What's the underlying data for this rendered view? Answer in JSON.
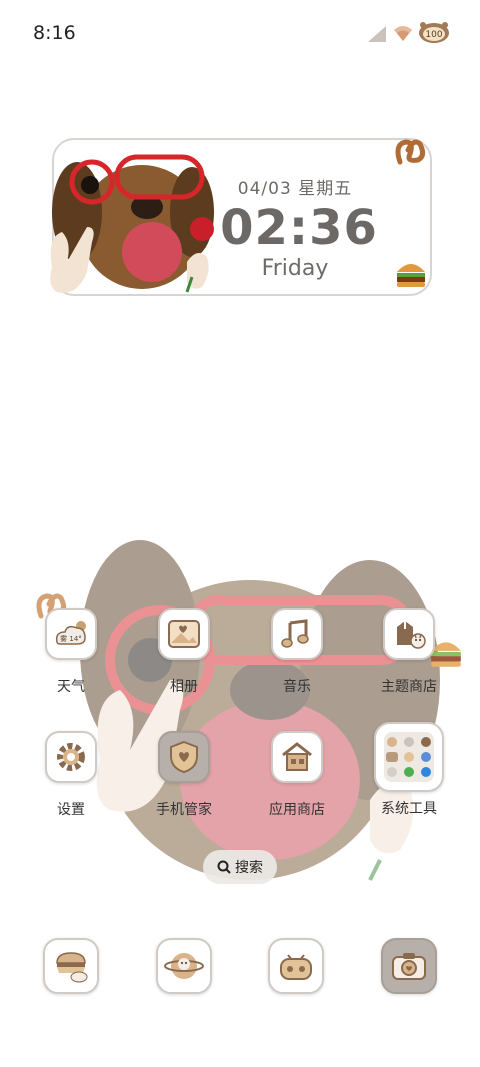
{
  "status_bar": {
    "time": "8:16",
    "battery": "100",
    "icons": [
      "signal-icon",
      "wifi-icon",
      "battery-icon"
    ]
  },
  "widget": {
    "date": "04/03 星期五",
    "time": "02:36",
    "weekday": "Friday"
  },
  "apps": {
    "weather": {
      "label": "天气",
      "badge": "雾 14°"
    },
    "gallery": {
      "label": "相册"
    },
    "music": {
      "label": "音乐"
    },
    "theme_store": {
      "label": "主题商店"
    },
    "settings": {
      "label": "设置"
    },
    "phone_manager": {
      "label": "手机管家"
    },
    "app_store": {
      "label": "应用商店"
    },
    "system_tools": {
      "label": "系统工具"
    }
  },
  "search": {
    "label": "搜索"
  },
  "dock": {
    "items": [
      "messages-icon",
      "browser-icon",
      "bilibili-icon",
      "camera-icon"
    ]
  },
  "colors": {
    "icon_brown": "#8a6a4e",
    "icon_tan": "#d9b38a",
    "widget_text": "#6b6866",
    "glasses_red": "#d7262a"
  }
}
